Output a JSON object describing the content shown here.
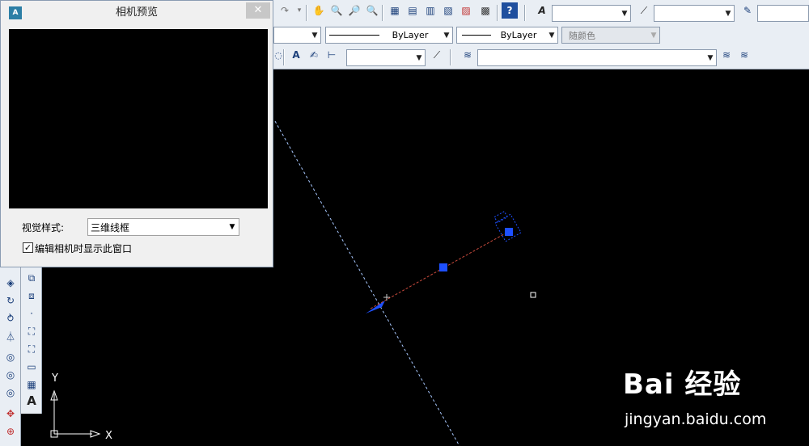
{
  "dialog": {
    "title": "相机预览",
    "close_label": "✕",
    "visual_style_label": "视觉样式:",
    "visual_style_value": "三维线框",
    "checkbox_label": "编辑相机时显示此窗口",
    "checkbox_checked": true,
    "checkbox_mark": "✓"
  },
  "toolbar": {
    "linetype_value": "ByLayer",
    "lineweight_value": "ByLayer",
    "color_value": "随颜色",
    "annotation_letter": "A"
  },
  "ucs": {
    "x_label": "X",
    "y_label": "Y"
  },
  "watermark": {
    "brand": "Bai 经验",
    "url": "jingyan.baidu.com"
  },
  "colors": {
    "toolbar_bg": "#e9eef4",
    "canvas_bg": "#000000",
    "grip_blue": "#1e50ff",
    "camera_line": "#c84a3c",
    "dashed_line": "#a8c8ff"
  }
}
